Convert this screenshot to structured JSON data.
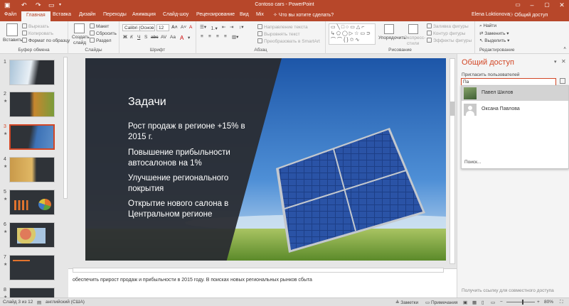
{
  "window": {
    "title": "Contoso cars - PowerPoint",
    "user": "Elena Loktionova",
    "share": "Общий доступ"
  },
  "tabs": [
    "Файл",
    "Главная",
    "Вставка",
    "Дизайн",
    "Переходы",
    "Анимация",
    "Слайд-шоу",
    "Рецензирование",
    "Вид",
    "Mix"
  ],
  "tell_me": "Что вы хотите сделать?",
  "ribbon": {
    "clipboard": {
      "paste": "Вставить",
      "cut": "Вырезать",
      "copy": "Копировать",
      "format_painter": "Формат по образцу",
      "label": "Буфер обмена"
    },
    "slides": {
      "new_slide_1": "Создать",
      "new_slide_2": "слайд",
      "layout": "Макет",
      "reset": "Сбросить",
      "section": "Раздел",
      "label": "Слайды"
    },
    "font": {
      "name": "Calibri (Основ",
      "size": "12",
      "label": "Шрифт"
    },
    "paragraph": {
      "text_direction": "Направление текста",
      "align_text": "Выровнять текст",
      "smartart": "Преобразовать в SmartArt",
      "label": "Абзац"
    },
    "drawing": {
      "arrange": "Упорядочить",
      "quick_styles_1": "Экспресс-",
      "quick_styles_2": "стили",
      "fill": "Заливка фигуры",
      "outline": "Контур фигуры",
      "effects": "Эффекты фигуры",
      "label": "Рисование"
    },
    "editing": {
      "find": "Найти",
      "replace": "Заменить",
      "select": "Выделить",
      "label": "Редактирование"
    }
  },
  "thumbnails": [
    "1",
    "2",
    "3",
    "4",
    "5",
    "6",
    "7",
    "8"
  ],
  "slide": {
    "title": "Задачи",
    "bullets": [
      "Рост продаж в регионе +15% в 2015 г.",
      "Повышение прибыльности автосалонов на 1%",
      "Улучшение регионального покрытия",
      "Открытие нового салона в Центральном регионе"
    ]
  },
  "notes": "обеспечить прирост продаж и прибыльности в 2015 году. В поисках новых региональных рынков сбыта",
  "share_panel": {
    "title": "Общий доступ",
    "invite_label": "Пригласить пользователей",
    "input_value": "Па",
    "suggestions": [
      "Павел Шилов",
      "Оксана Павлова"
    ],
    "search": "Поиск...",
    "link": "Получить ссылку для совместного доступа"
  },
  "status": {
    "slide": "Слайд 3 из 12",
    "language": "английский (США)",
    "notes": "Заметки",
    "comments": "Примечания",
    "zoom": "80%"
  },
  "colors": {
    "accent": "#b7472a",
    "selection": "#d24726"
  }
}
